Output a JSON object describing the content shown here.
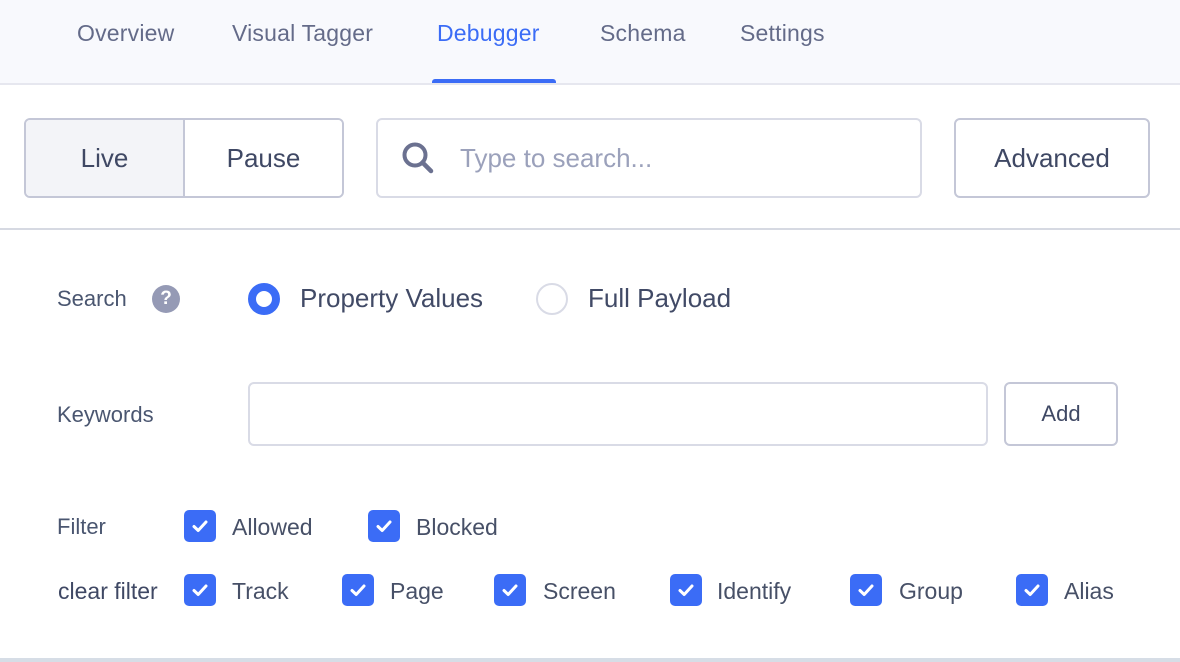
{
  "tabs": [
    {
      "label": "Overview",
      "active": false
    },
    {
      "label": "Visual Tagger",
      "active": false
    },
    {
      "label": "Debugger",
      "active": true
    },
    {
      "label": "Schema",
      "active": false
    },
    {
      "label": "Settings",
      "active": false
    }
  ],
  "toolbar": {
    "live_label": "Live",
    "pause_label": "Pause",
    "mode_selected": "Live",
    "search_placeholder": "Type to search...",
    "search_value": "",
    "advanced_label": "Advanced"
  },
  "advanced": {
    "search_label": "Search",
    "search_options": [
      {
        "label": "Property Values",
        "selected": true
      },
      {
        "label": "Full Payload",
        "selected": false
      }
    ],
    "keywords_label": "Keywords",
    "keywords_value": "",
    "add_label": "Add",
    "filter_label": "Filter",
    "filter_options": [
      {
        "label": "Allowed",
        "checked": true
      },
      {
        "label": "Blocked",
        "checked": true
      }
    ],
    "clear_filter_label": "clear filter",
    "event_types": [
      {
        "label": "Track",
        "checked": true
      },
      {
        "label": "Page",
        "checked": true
      },
      {
        "label": "Screen",
        "checked": true
      },
      {
        "label": "Identify",
        "checked": true
      },
      {
        "label": "Group",
        "checked": true
      },
      {
        "label": "Alias",
        "checked": true
      }
    ]
  },
  "colors": {
    "accent": "#3b6cf6",
    "text": "#475067",
    "muted": "#646b89",
    "border": "#c4c7d7"
  }
}
